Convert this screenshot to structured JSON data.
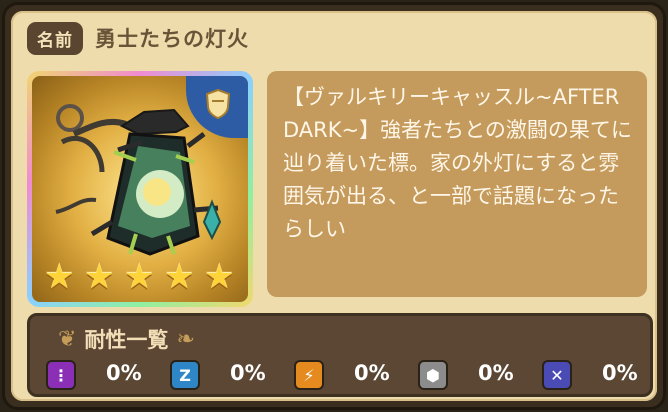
{
  "header": {
    "name_label": "名前",
    "item_name": "勇士たちの灯火"
  },
  "description": {
    "text": "【ヴァルキリーキャッスル~AFTER DARK~】強者たちとの激闘の果てに辿り着いた標。家の外灯にすると雰囲気が出る、と一部で話題になったらしい"
  },
  "resistance": {
    "title": "耐性一覧",
    "items": [
      {
        "icon": "poison-icon",
        "value": "0%",
        "color": "#8a2fb6"
      },
      {
        "icon": "sleep-icon",
        "value": "0%",
        "color": "#2f86c6"
      },
      {
        "icon": "lightning-icon",
        "value": "0%",
        "color": "#e58a1f"
      },
      {
        "icon": "gear-icon",
        "value": "0%",
        "color": "#8c8c8c"
      },
      {
        "icon": "close-icon",
        "value": "0%",
        "color": "#4b4bb6"
      }
    ]
  },
  "card": {
    "rarity_stars": 5,
    "badge_icon": "shield-icon"
  }
}
